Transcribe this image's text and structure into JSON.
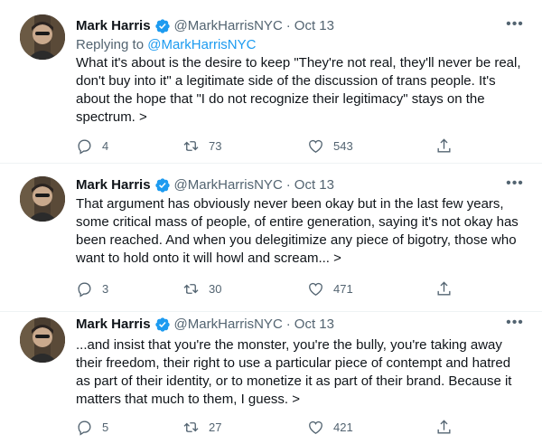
{
  "tweets": [
    {
      "name": "Mark Harris",
      "handle": "@MarkHarrisNYC",
      "separator": "·",
      "date": "Oct 13",
      "reply_prefix": "Replying to",
      "reply_to": "@MarkHarrisNYC",
      "text": "What it's about is the desire to keep \"They're not real, they'll never be real, don't buy into it\" a legitimate side of the discussion of trans people. It's about the hope that \"I do not recognize their legitimacy\" stays on the spectrum. >",
      "replies": "4",
      "retweets": "73",
      "likes": "543"
    },
    {
      "name": "Mark Harris",
      "handle": "@MarkHarrisNYC",
      "separator": "·",
      "date": "Oct 13",
      "text": "That argument has obviously never been okay but in the last few years, some critical mass of people, of entire generation, saying it's not okay has been reached. And when you delegitimize any piece of bigotry, those who want to hold onto it will howl and scream... >",
      "replies": "3",
      "retweets": "30",
      "likes": "471"
    },
    {
      "name": "Mark Harris",
      "handle": "@MarkHarrisNYC",
      "separator": "·",
      "date": "Oct 13",
      "text": "...and insist that you're the monster, you're the bully, you're taking away their freedom, their right to use a particular piece of contempt and hatred as part of their identity, or to monetize it as part of their brand. Because it matters that much to them, I guess. >",
      "replies": "5",
      "retweets": "27",
      "likes": "421"
    }
  ],
  "icons": {
    "verified": "verified-badge-icon",
    "more": "more-icon",
    "reply": "reply-icon",
    "retweet": "retweet-icon",
    "like": "like-icon",
    "share": "share-icon"
  },
  "colors": {
    "accent": "#1d9bf0",
    "secondary_text": "#536471",
    "primary_text": "#0f1419"
  }
}
